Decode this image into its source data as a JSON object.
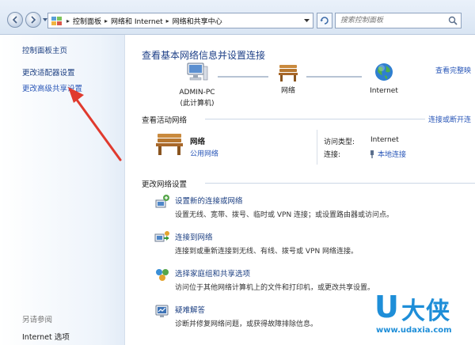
{
  "address_bar": {
    "breadcrumbs": [
      "控制面板",
      "网络和 Internet",
      "网络和共享中心"
    ],
    "search_placeholder": "搜索控制面板"
  },
  "sidebar": {
    "home": "控制面板主页",
    "adapter": "更改适配器设置",
    "advanced": "更改高级共享设置",
    "see_also": "另请参阅",
    "internet_options": "Internet 选项"
  },
  "main": {
    "title": "查看基本网络信息并设置连接",
    "full_map": "查看完整映",
    "nodes": {
      "pc_name": "ADMIN-PC",
      "pc_sub": "(此计算机)",
      "network": "网络",
      "internet": "Internet"
    },
    "active": {
      "heading": "查看活动网络",
      "disconnect": "连接或断开连",
      "name": "网络",
      "type": "公用网络",
      "access_label": "访问类型:",
      "access_value": "Internet",
      "conn_label": "连接:",
      "conn_value": "本地连接"
    },
    "change": {
      "heading": "更改网络设置",
      "tasks": [
        {
          "title": "设置新的连接或网络",
          "desc": "设置无线、宽带、拨号、临时或 VPN 连接；或设置路由器或访问点。",
          "icon": "new-connection-icon"
        },
        {
          "title": "连接到网络",
          "desc": "连接到或重新连接到无线、有线、拨号或 VPN 网络连接。",
          "icon": "connect-network-icon"
        },
        {
          "title": "选择家庭组和共享选项",
          "desc": "访问位于其他网络计算机上的文件和打印机，或更改共享设置。",
          "icon": "homegroup-icon"
        },
        {
          "title": "疑难解答",
          "desc": "诊断并修复网络问题，或获得故障排除信息。",
          "icon": "troubleshoot-icon"
        }
      ]
    }
  },
  "watermark": {
    "logo_u": "U",
    "logo_text": "大侠",
    "url": "www.udaxia.com"
  },
  "colors": {
    "link": "#2a57b8",
    "title": "#1d3f87",
    "arrow": "#e03a2e",
    "watermark": "#1e8ed8"
  }
}
